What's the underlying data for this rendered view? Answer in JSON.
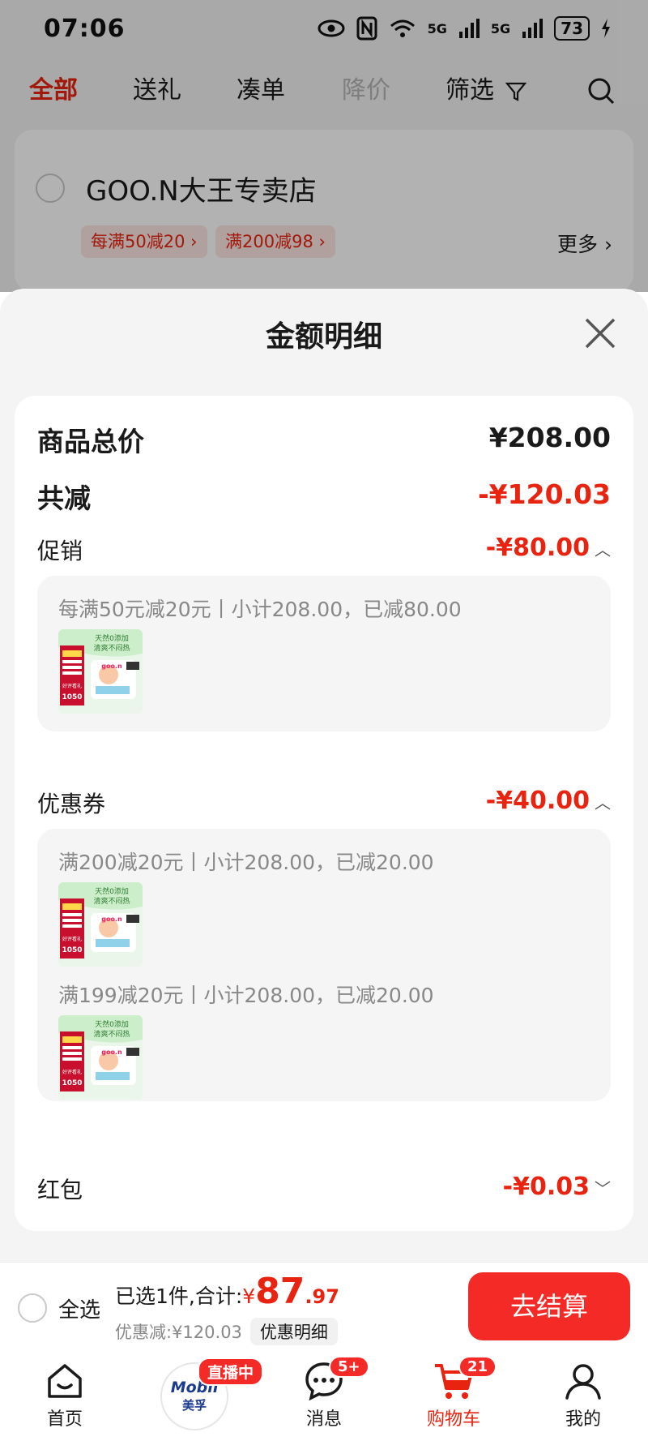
{
  "status_bar": {
    "time": "07:06",
    "battery": "73",
    "net1": "5G",
    "net2": "5G",
    "wifi_tag": "6"
  },
  "tabs": [
    {
      "label": "全部"
    },
    {
      "label": "送礼"
    },
    {
      "label": "凑单"
    },
    {
      "label": "降价"
    },
    {
      "label": "筛选"
    }
  ],
  "store": {
    "name": "GOO.N大王专卖店",
    "tags": [
      "每满50减20 ›",
      "满200减98 ›"
    ],
    "more": "更多 ›"
  },
  "sheet": {
    "title": "金额明细",
    "total_label": "商品总价",
    "total_value": "¥208.00",
    "reduce_label": "共减",
    "reduce_value": "-¥120.03",
    "promo": {
      "label": "促销",
      "value": "-¥80.00",
      "items": [
        {
          "text": "每满50元减20元丨小计208.00，已减80.00"
        }
      ]
    },
    "coupon": {
      "label": "优惠券",
      "value": "-¥40.00",
      "items": [
        {
          "text": "满200减20元丨小计208.00，已减20.00"
        },
        {
          "text": "满199减20元丨小计208.00，已减20.00"
        }
      ]
    },
    "redpacket": {
      "label": "红包",
      "value": "-¥0.03"
    },
    "product_thumb": {
      "top_text1": "天然0添加",
      "top_text2": "清爽不闷热",
      "left_badge": "好评看礼",
      "count": "1050",
      "brand": "goo.n"
    }
  },
  "checkout": {
    "select_all": "全选",
    "summary_prefix": "已选1件,合计:",
    "currency": "¥",
    "price_int": "87",
    "price_dec": ".97",
    "discount": "优惠减:¥120.03",
    "detail_chip": "优惠明细",
    "button": "去结算"
  },
  "nav": {
    "home": "首页",
    "live_badge": "直播中",
    "live_brand": "Mobil",
    "live_brand_sub": "美孚",
    "messages": "消息",
    "messages_badge": "5+",
    "cart": "购物车",
    "cart_badge": "21",
    "mine": "我的"
  },
  "colors": {
    "accent": "#e8230f",
    "button": "#f42a26"
  }
}
